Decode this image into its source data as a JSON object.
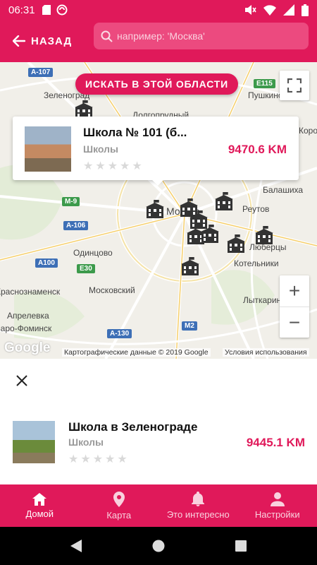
{
  "status": {
    "time": "06:31"
  },
  "header": {
    "back_label": "НАЗАД",
    "search_placeholder": "например: 'Москва'"
  },
  "map": {
    "search_area_label": "ИСКАТЬ В ЭТОЙ ОБЛАСТИ",
    "labels": [
      "Зеленоград",
      "Долгопрудный",
      "Пушкино",
      "Королёв",
      "Балашиха",
      "Реутов",
      "Москва",
      "Люберцы",
      "Котельники",
      "Одинцово",
      "Московский",
      "Лыткарино",
      "Краснознаменск",
      "Апрелевка",
      "Наро-Фоминск"
    ],
    "road_badges": [
      "A-107",
      "E115",
      "M-9",
      "A-106",
      "A100",
      "E30",
      "A-130",
      "M2"
    ],
    "google_logo": "Google",
    "attribution": "Картографические данные © 2019 Google",
    "terms": "Условия использования",
    "zoom_in": "+",
    "zoom_out": "−"
  },
  "popup_card": {
    "title": "Школа № 101 (б...",
    "category": "Школы",
    "distance": "9470.6 KM",
    "rating": 0
  },
  "list": {
    "items": [
      {
        "title": "Школа в Зеленограде",
        "category": "Школы",
        "distance": "9445.1 KM",
        "rating": 0
      }
    ]
  },
  "bottom_nav": {
    "items": [
      {
        "label": "Домой",
        "icon": "home-icon",
        "active": true
      },
      {
        "label": "Карта",
        "icon": "map-pin-icon",
        "active": false
      },
      {
        "label": "Это интересно",
        "icon": "bell-icon",
        "active": false
      },
      {
        "label": "Настройки",
        "icon": "person-icon",
        "active": false
      }
    ]
  },
  "colors": {
    "accent": "#e0195a",
    "map_bg": "#f1efe9",
    "road": "#ffffff",
    "highway": "#f6cf6b"
  }
}
